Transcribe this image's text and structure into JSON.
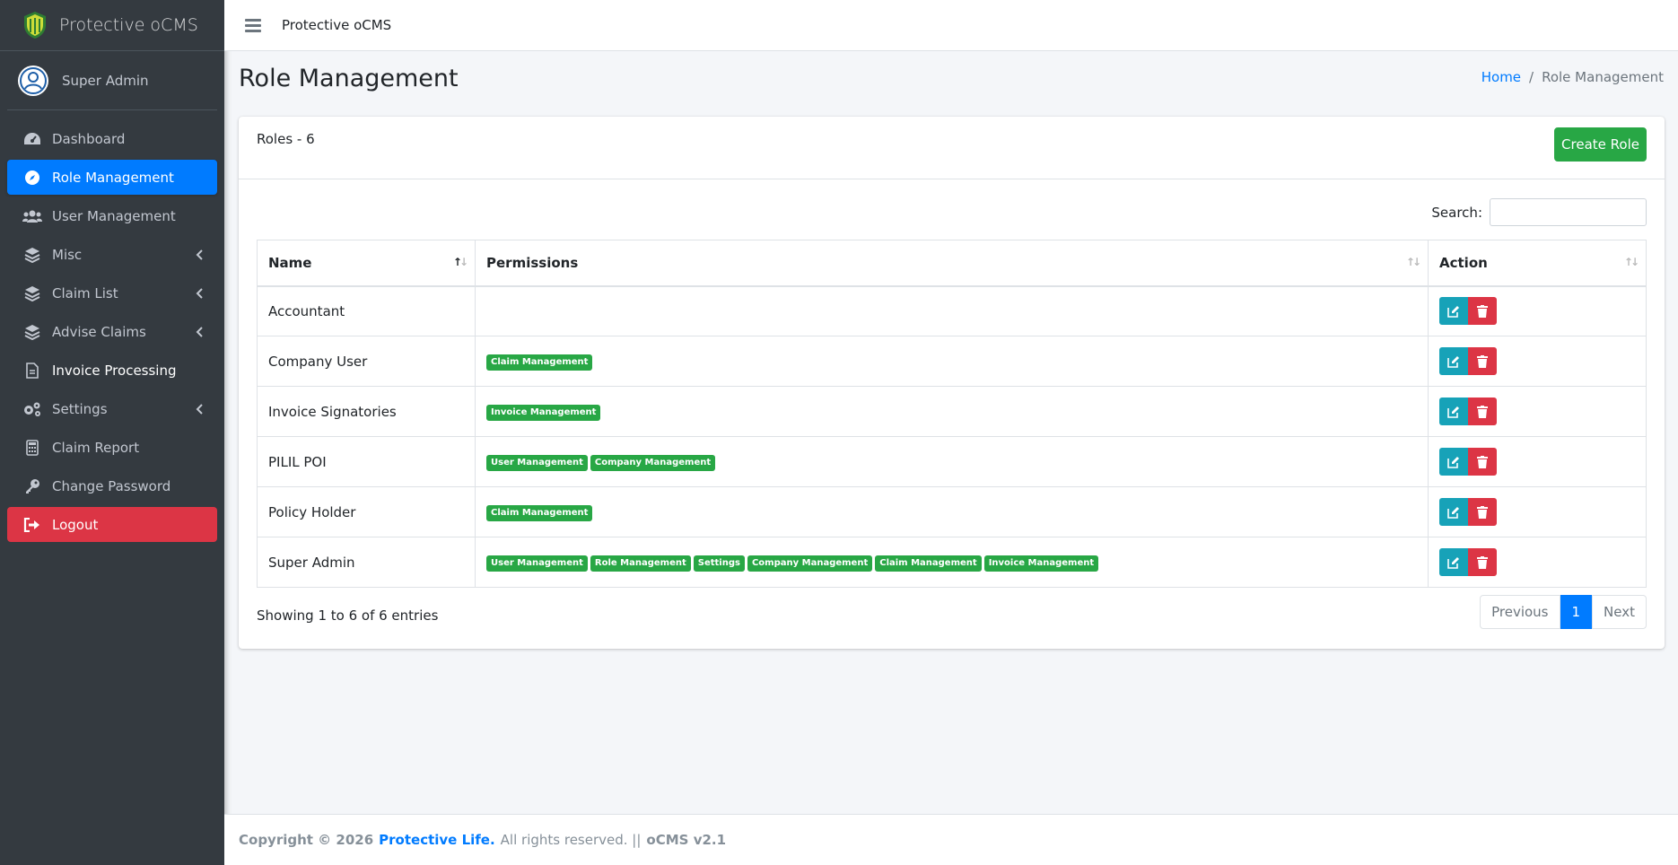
{
  "brand": {
    "name": "Protective oCMS"
  },
  "user": {
    "name": "Super Admin"
  },
  "sidebar": {
    "items": [
      {
        "label": "Dashboard",
        "icon": "dashboard-icon"
      },
      {
        "label": "Role Management",
        "icon": "compass-icon",
        "active": true
      },
      {
        "label": "User Management",
        "icon": "users-icon"
      },
      {
        "label": "Misc",
        "icon": "layers-icon",
        "has_submenu": true
      },
      {
        "label": "Claim List",
        "icon": "layers-icon",
        "has_submenu": true
      },
      {
        "label": "Advise Claims",
        "icon": "layers-icon",
        "has_submenu": true
      },
      {
        "label": "Invoice Processing",
        "icon": "file-icon"
      },
      {
        "label": "Settings",
        "icon": "gears-icon",
        "has_submenu": true
      },
      {
        "label": "Claim Report",
        "icon": "calculator-icon"
      },
      {
        "label": "Change Password",
        "icon": "key-icon"
      },
      {
        "label": "Logout",
        "icon": "sign-out-icon"
      }
    ]
  },
  "topbar": {
    "title": "Protective oCMS"
  },
  "page": {
    "title": "Role Management"
  },
  "breadcrumb": {
    "home": "Home",
    "current": "Role Management"
  },
  "card": {
    "title": "Roles - 6",
    "create_label": "Create Role"
  },
  "search": {
    "label": "Search:",
    "value": ""
  },
  "table": {
    "headers": {
      "name": "Name",
      "permissions": "Permissions",
      "action": "Action"
    },
    "rows": [
      {
        "name": "Accountant",
        "permissions": []
      },
      {
        "name": "Company User",
        "permissions": [
          "Claim Management"
        ]
      },
      {
        "name": "Invoice Signatories",
        "permissions": [
          "Invoice Management"
        ]
      },
      {
        "name": "PILIL POI",
        "permissions": [
          "User Management",
          "Company Management"
        ]
      },
      {
        "name": "Policy Holder",
        "permissions": [
          "Claim Management"
        ]
      },
      {
        "name": "Super Admin",
        "permissions": [
          "User Management",
          "Role Management",
          "Settings",
          "Company Management",
          "Claim Management",
          "Invoice Management"
        ]
      }
    ]
  },
  "pagination": {
    "info": "Showing 1 to 6 of 6 entries",
    "previous": "Previous",
    "current": "1",
    "next": "Next"
  },
  "footer": {
    "copyright": "Copyright © 2026",
    "company": "Protective Life.",
    "rights": "All rights reserved. ||",
    "version": "oCMS v2.1"
  },
  "colors": {
    "primary": "#007bff",
    "success": "#28a745",
    "danger": "#dc3545",
    "info": "#17a2b8",
    "sidebar": "#343a40"
  }
}
